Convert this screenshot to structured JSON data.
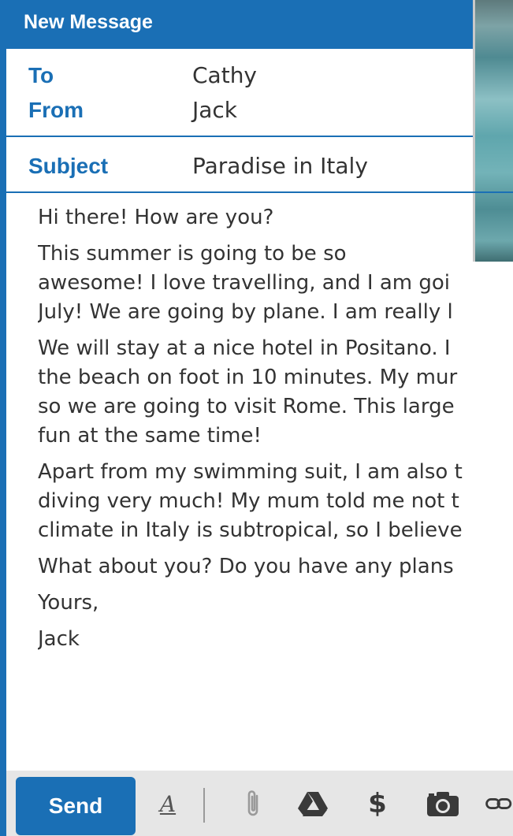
{
  "window": {
    "title": "New Message"
  },
  "header": {
    "to_label": "To",
    "to_value": "Cathy",
    "from_label": "From",
    "from_value": "Jack",
    "subject_label": "Subject",
    "subject_value": "Paradise in Italy"
  },
  "body": {
    "greeting": "Hi there! How are you?",
    "p1_line1": "This summer is going to be so",
    "p1_line2": "awesome! I love travelling, and I am goi",
    "p1_line3": "July! We are going by plane. I am really l",
    "p2_line1": "We will stay at a nice hotel in Positano. I",
    "p2_line2": "the beach on foot in 10 minutes. My mur",
    "p2_line3": "so we are going to visit Rome. This large",
    "p2_line4": "fun at the same time!",
    "p3_line1": "Apart from my swimming suit, I am also t",
    "p3_line2": "diving very much! My mum told me not t",
    "p3_line3": "climate in Italy is subtropical, so I believe",
    "p4_line1": "What about you? Do you have any plans",
    "closing": "Yours,",
    "signature": "Jack"
  },
  "toolbar": {
    "send_label": "Send",
    "format_glyph": "A",
    "dollar_glyph": "$",
    "icons": [
      "format-text-icon",
      "attachment-icon",
      "drive-icon",
      "dollar-icon",
      "camera-icon",
      "link-icon"
    ]
  },
  "colors": {
    "accent": "#1a6fb5",
    "toolbar_bg": "#e6e6e6",
    "text": "#333333"
  }
}
